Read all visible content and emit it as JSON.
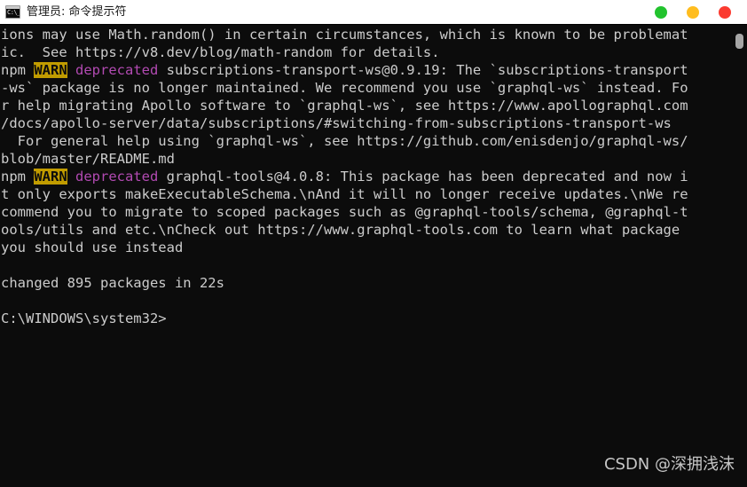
{
  "window": {
    "title": "管理员: 命令提示符",
    "icon_glyph": "C:\\_",
    "icon_name": "cmd-icon",
    "background_color": "#0c0c0c",
    "titlebar_color": "#ffffff"
  },
  "window_controls": [
    {
      "name": "minimize-button",
      "color": "#22c32e",
      "label": ""
    },
    {
      "name": "maximize-button",
      "color": "#ffbd1f",
      "label": ""
    },
    {
      "name": "close-button",
      "color": "#fb3b30",
      "label": ""
    }
  ],
  "console": {
    "foreground_color": "#cccccc",
    "warn_badge_bg": "#c19c00",
    "warn_badge_fg": "#0c0c0c",
    "deprecated_color": "#b24ab2",
    "lines": [
      {
        "segments": [
          {
            "type": "text",
            "text": "ions may use Math.random() in certain circumstances, which is known to be problemat"
          }
        ]
      },
      {
        "segments": [
          {
            "type": "text",
            "text": "ic.  See https://v8.dev/blog/math-random for details."
          }
        ]
      },
      {
        "segments": [
          {
            "type": "text",
            "text": "npm "
          },
          {
            "type": "warn",
            "text": "WARN"
          },
          {
            "type": "text",
            "text": " "
          },
          {
            "type": "deprecated",
            "text": "deprecated"
          },
          {
            "type": "text",
            "text": " subscriptions-transport-ws@0.9.19: The `subscriptions-transport"
          }
        ]
      },
      {
        "segments": [
          {
            "type": "text",
            "text": "-ws` package is no longer maintained. We recommend you use `graphql-ws` instead. Fo"
          }
        ]
      },
      {
        "segments": [
          {
            "type": "text",
            "text": "r help migrating Apollo software to `graphql-ws`, see https://www.apollographql.com"
          }
        ]
      },
      {
        "segments": [
          {
            "type": "text",
            "text": "/docs/apollo-server/data/subscriptions/#switching-from-subscriptions-transport-ws"
          }
        ]
      },
      {
        "segments": [
          {
            "type": "text",
            "text": "  For general help using `graphql-ws`, see https://github.com/enisdenjo/graphql-ws/"
          }
        ]
      },
      {
        "segments": [
          {
            "type": "text",
            "text": "blob/master/README.md"
          }
        ]
      },
      {
        "segments": [
          {
            "type": "text",
            "text": "npm "
          },
          {
            "type": "warn",
            "text": "WARN"
          },
          {
            "type": "text",
            "text": " "
          },
          {
            "type": "deprecated",
            "text": "deprecated"
          },
          {
            "type": "text",
            "text": " graphql-tools@4.0.8: This package has been deprecated and now i"
          }
        ]
      },
      {
        "segments": [
          {
            "type": "text",
            "text": "t only exports makeExecutableSchema.\\nAnd it will no longer receive updates.\\nWe re"
          }
        ]
      },
      {
        "segments": [
          {
            "type": "text",
            "text": "commend you to migrate to scoped packages such as @graphql-tools/schema, @graphql-t"
          }
        ]
      },
      {
        "segments": [
          {
            "type": "text",
            "text": "ools/utils and etc.\\nCheck out https://www.graphql-tools.com to learn what package"
          }
        ]
      },
      {
        "segments": [
          {
            "type": "text",
            "text": "you should use instead"
          }
        ]
      },
      {
        "segments": []
      },
      {
        "segments": [
          {
            "type": "text",
            "text": "changed 895 packages in 22s"
          }
        ]
      },
      {
        "segments": []
      },
      {
        "segments": [
          {
            "type": "text",
            "text": "C:\\WINDOWS\\system32>"
          }
        ]
      }
    ]
  },
  "scrollbar": {
    "thumb_color": "#a6a6a6",
    "position_percent": 2
  },
  "watermark": {
    "text": "CSDN @深拥浅沫"
  }
}
